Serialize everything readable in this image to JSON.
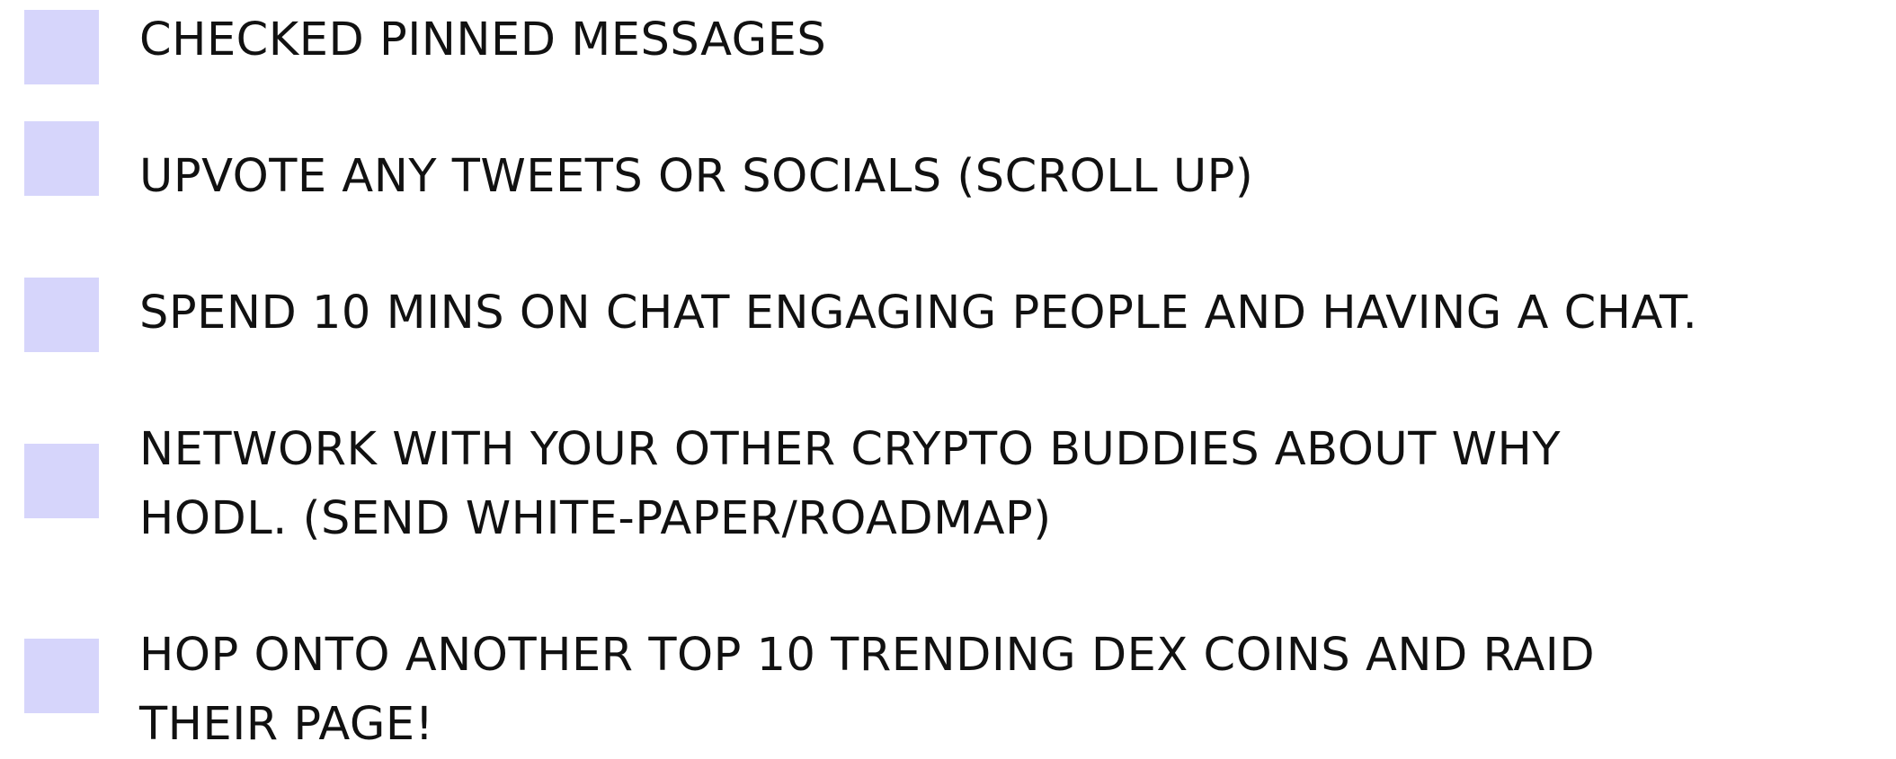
{
  "checklist": {
    "items": [
      {
        "label": "CHECKED PINNED MESSAGES",
        "checked": false
      },
      {
        "label": "UPVOTE ANY TWEETS OR SOCIALS (SCROLL UP)",
        "checked": false
      },
      {
        "label": "SPEND 10 MINS ON CHAT ENGAGING PEOPLE AND HAVING A CHAT.",
        "checked": false
      },
      {
        "label": "NETWORK WITH YOUR OTHER CRYPTO BUDDIES ABOUT WHY\nHODL. (SEND WHITE-PAPER/ROADMAP)",
        "checked": false
      },
      {
        "label": "HOP ONTO ANOTHER TOP 10 TRENDING DEX COINS AND RAID\nTHEIR PAGE!",
        "checked": false
      }
    ],
    "checkbox_color": "#d6d5fb",
    "text_color": "#111111"
  }
}
